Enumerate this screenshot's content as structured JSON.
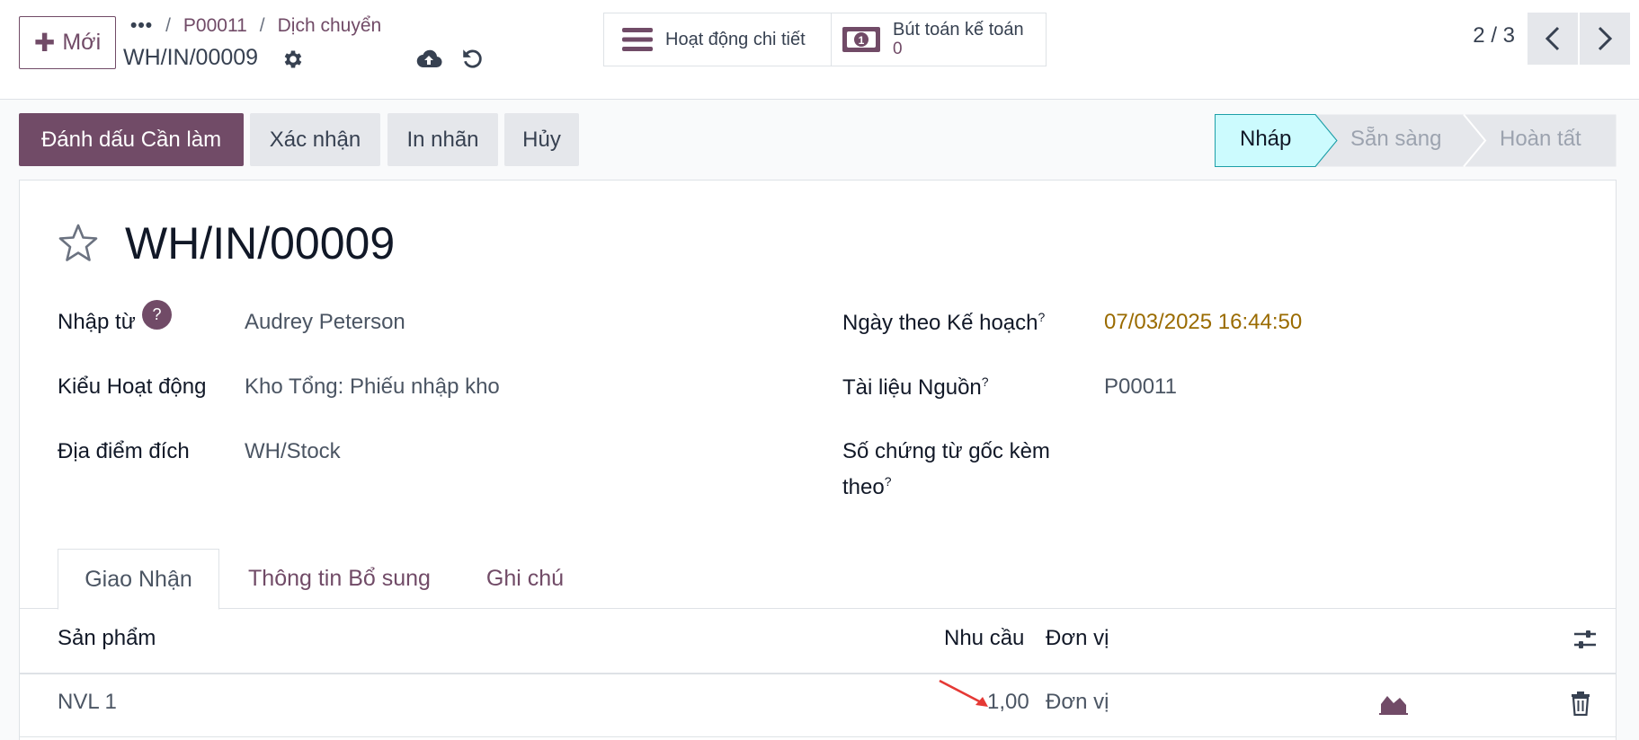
{
  "header": {
    "new_button": {
      "icon": "plus-icon",
      "label": "Mới"
    },
    "breadcrumb": {
      "more": "•••",
      "sep": "/",
      "items": [
        "P00011",
        "Dịch chuyển"
      ]
    },
    "record_name": "WH/IN/00009",
    "icons": [
      "gear-icon",
      "cloud-upload-icon",
      "discard-icon"
    ]
  },
  "smart_buttons": {
    "activity": {
      "icon": "list-icon",
      "label": "Hoạt động chi tiết"
    },
    "accounting": {
      "icon": "money-icon",
      "label": "Bút toán kế toán",
      "count": "0"
    }
  },
  "pager": {
    "text": "2 / 3"
  },
  "actions": {
    "mark_todo": "Đánh dấu Cần làm",
    "confirm": "Xác nhận",
    "print_labels": "In nhãn",
    "cancel": "Hủy"
  },
  "statusbar": {
    "stages": [
      "Nháp",
      "Sẵn sàng",
      "Hoàn tất"
    ],
    "active": "Nháp",
    "active_color": "#ccfbfe"
  },
  "form": {
    "title": "WH/IN/00009",
    "left": [
      {
        "label": "Nhập từ",
        "value": "Audrey Peterson",
        "help": "?"
      },
      {
        "label": "Kiểu Hoạt động",
        "value": "Kho Tổng: Phiếu nhập kho"
      },
      {
        "label": "Địa điểm đích",
        "value": "WH/Stock"
      }
    ],
    "right": [
      {
        "label": "Ngày theo Kế hoạch",
        "value": "07/03/2025 16:44:50",
        "tooltip": "?"
      },
      {
        "label": "Tài liệu Nguồn",
        "value": "P00011",
        "tooltip": "?"
      },
      {
        "label_line1": "Số chứng từ gốc kèm",
        "label_line2": "theo",
        "value": "",
        "tooltip": "?"
      }
    ]
  },
  "tabs": [
    "Giao Nhận",
    "Thông tin Bổ sung",
    "Ghi chú"
  ],
  "table": {
    "columns": [
      "Sản phẩm",
      "Nhu cầu",
      "Đơn vị"
    ],
    "rows": [
      {
        "product": "NVL 1",
        "demand": "1,00",
        "uom": "Đơn vị"
      }
    ]
  },
  "colors": {
    "brand": "#714b67",
    "date": "#9a6b00",
    "annotation": "#e53935"
  }
}
